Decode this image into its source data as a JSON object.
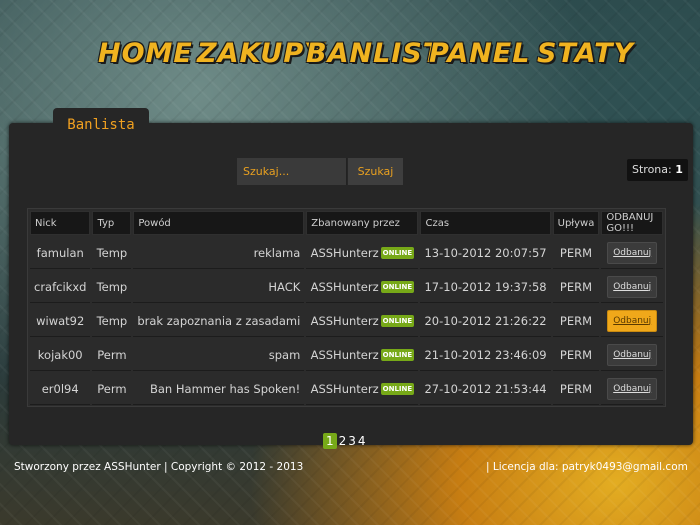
{
  "nav": {
    "home": "HOME",
    "zakupy": "ZAKUPY",
    "banlist": "BANLIST",
    "panel": "PANEL",
    "staty": "STATY"
  },
  "panel_tab": "Banlista",
  "search": {
    "placeholder": "Szukaj...",
    "button": "Szukaj"
  },
  "page_indicator": {
    "label": "Strona:",
    "value": "1"
  },
  "table": {
    "headers": [
      "Nick",
      "Typ",
      "Powód",
      "Zbanowany przez",
      "Czas",
      "Upływa",
      "ODBANUJ GO!!!"
    ],
    "rows": [
      {
        "nick": "famulan",
        "typ": "Temp",
        "powod": "reklama",
        "admin": "ASSHunterz",
        "status": "ONLINE",
        "czas": "13-10-2012 20:07:57",
        "uplywa": "PERM",
        "action": "Odbanuj"
      },
      {
        "nick": "crafcikxd",
        "typ": "Temp",
        "powod": "HACK",
        "admin": "ASSHunterz",
        "status": "ONLINE",
        "czas": "17-10-2012 19:37:58",
        "uplywa": "PERM",
        "action": "Odbanuj"
      },
      {
        "nick": "wiwat92",
        "typ": "Temp",
        "powod": "brak zapoznania z zasadami",
        "admin": "ASSHunterz",
        "status": "ONLINE",
        "czas": "20-10-2012 21:26:22",
        "uplywa": "PERM",
        "action": "Odbanuj"
      },
      {
        "nick": "kojak00",
        "typ": "Perm",
        "powod": "spam",
        "admin": "ASSHunterz",
        "status": "ONLINE",
        "czas": "21-10-2012 23:46:09",
        "uplywa": "PERM",
        "action": "Odbanuj"
      },
      {
        "nick": "er0l94",
        "typ": "Perm",
        "powod": "Ban Hammer has Spoken!",
        "admin": "ASSHunterz",
        "status": "ONLINE",
        "czas": "27-10-2012 21:53:44",
        "uplywa": "PERM",
        "action": "Odbanuj"
      }
    ]
  },
  "pagination": {
    "current": "1",
    "pages": [
      "2",
      "3",
      "4"
    ]
  },
  "footer": {
    "left": "Stworzony przez ASSHunter | Copyright © 2012 - 2013",
    "right": "| Licencja dla: patryk0493@gmail.com"
  },
  "colors": {
    "accent": "#f0b320",
    "online": "#77a918",
    "highlight_button": "#f0a81a"
  }
}
